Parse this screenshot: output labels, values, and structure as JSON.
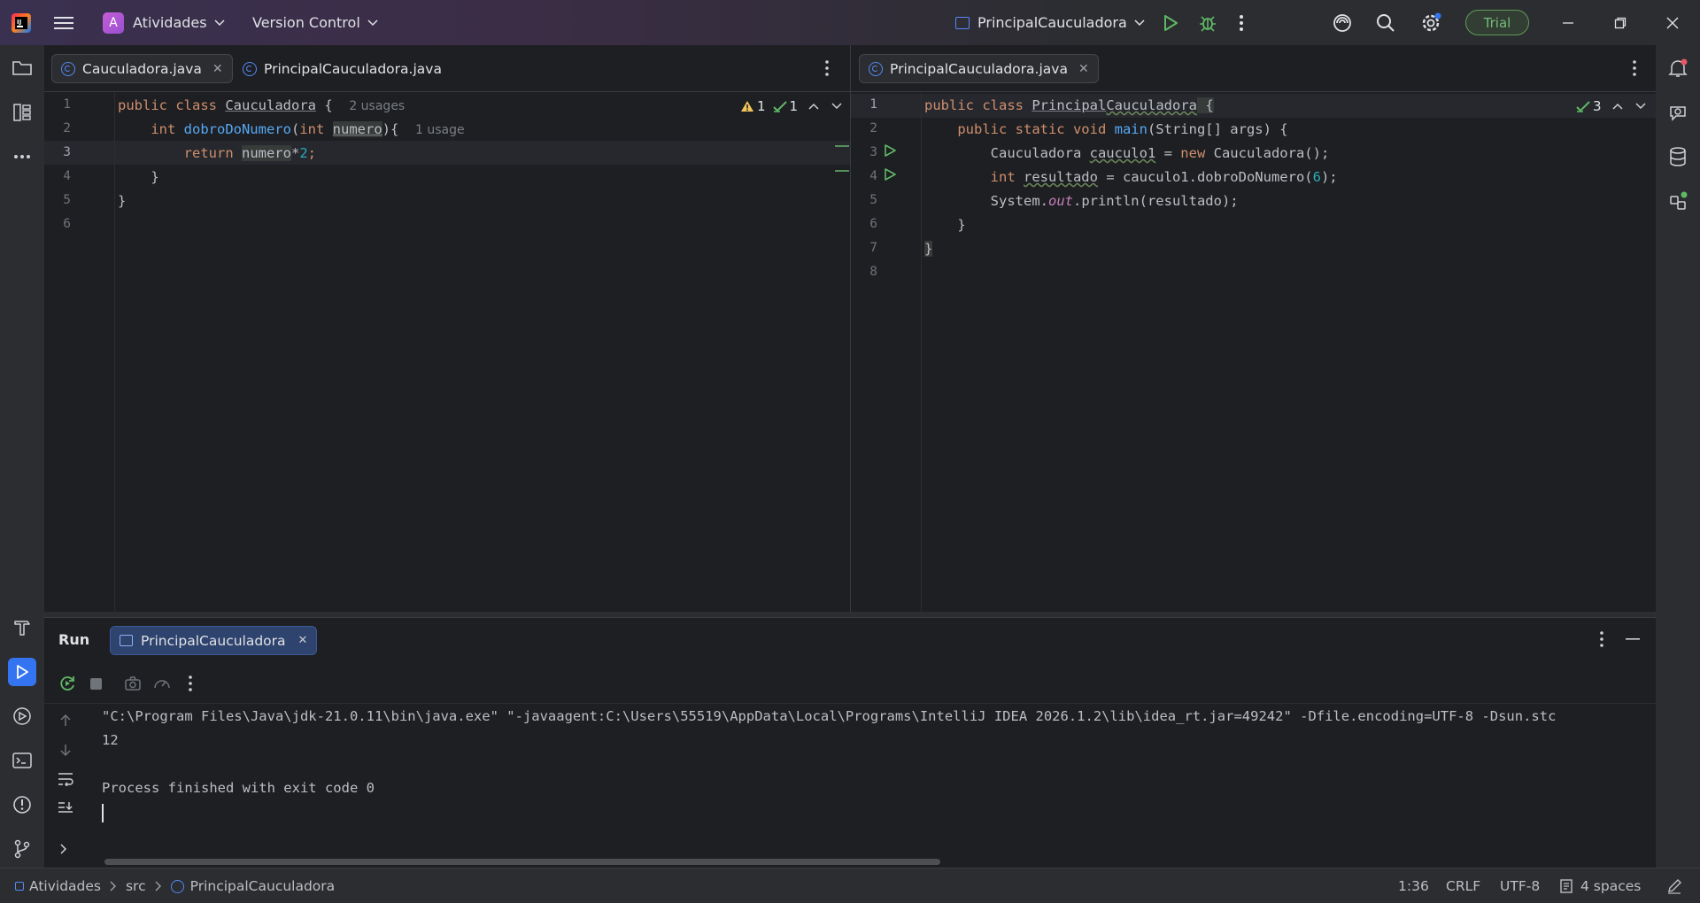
{
  "titlebar": {
    "project_initial": "A",
    "project_name": "Atividades",
    "vcs": "Version Control",
    "run_config": "PrincipalCauculadora",
    "trial": "Trial"
  },
  "left_editor": {
    "tabs": [
      {
        "label": "Cauculadora.java",
        "active": true
      },
      {
        "label": "PrincipalCauculadora.java",
        "active": false
      }
    ],
    "inspections": {
      "warnings": "1",
      "ok": "1"
    },
    "line_numbers": [
      "1",
      "2",
      "3",
      "4",
      "5",
      "6"
    ],
    "lines": {
      "l1": {
        "kw": "public class ",
        "name": "Cauculadora",
        "rest": " {",
        "hint": "2 usages"
      },
      "l2": {
        "kw": "int ",
        "fn": "dobroDoNumero",
        "p1": "(",
        "kw2": "int ",
        "param": "numero",
        "p2": "){",
        "hint": "1 usage"
      },
      "l3": {
        "kw": "return ",
        "var": "numero",
        "op": "*",
        "num": "2",
        "end": ";"
      },
      "l4": "}",
      "l5": "}"
    }
  },
  "right_editor": {
    "tabs": [
      {
        "label": "PrincipalCauculadora.java",
        "active": true
      }
    ],
    "inspections": {
      "ok": "3"
    },
    "line_numbers": [
      "1",
      "2",
      "3",
      "4",
      "5",
      "6",
      "7",
      "8"
    ],
    "lines": {
      "l1": {
        "kw": "public class ",
        "name_a": "Principal",
        "name_b": "Cauculadora",
        "rest": " {"
      },
      "l2": {
        "kw": "public static void ",
        "fn": "main",
        "rest": "(String[] args) {"
      },
      "l3": {
        "type": "Cauculadora ",
        "var": "cauculo1",
        "eq": " = ",
        "kw": "new ",
        "rest": "Cauculadora();"
      },
      "l4": {
        "kw": "int ",
        "var": "resultado",
        "eq": " = cauculo1.dobroDoNumero(",
        "num": "6",
        "end": ");"
      },
      "l5": {
        "a": "System.",
        "field": "out",
        "b": ".println(resultado);"
      },
      "l6": "}",
      "l7": "}"
    }
  },
  "run_panel": {
    "title": "Run",
    "tab": "PrincipalCauculadora",
    "console": [
      "\"C:\\Program Files\\Java\\jdk-21.0.11\\bin\\java.exe\" \"-javaagent:C:\\Users\\55519\\AppData\\Local\\Programs\\IntelliJ IDEA 2026.1.2\\lib\\idea_rt.jar=49242\" -Dfile.encoding=UTF-8 -Dsun.stc",
      "12",
      "",
      "Process finished with exit code 0"
    ]
  },
  "statusbar": {
    "breadcrumb": [
      "Atividades",
      "src",
      "PrincipalCauculadora"
    ],
    "position": "1:36",
    "line_sep": "CRLF",
    "encoding": "UTF-8",
    "indent": "4 spaces"
  },
  "colors": {
    "accent": "#3574f0",
    "trial_green": "#73bd79",
    "keyword": "#cf8e6d",
    "function": "#56a8f5",
    "number": "#2aacb8"
  }
}
